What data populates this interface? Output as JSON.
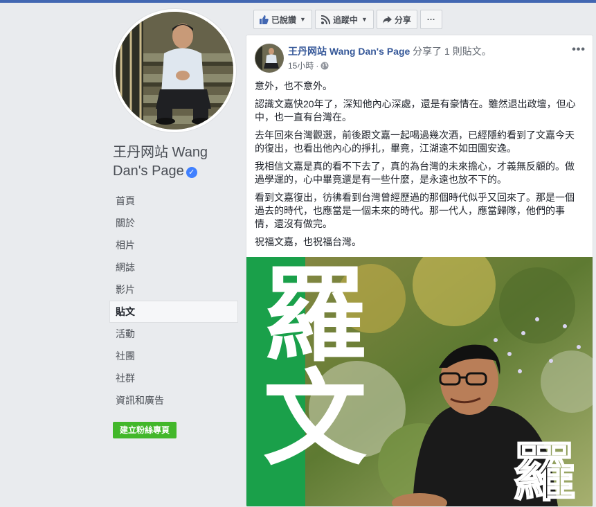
{
  "page": {
    "name": "王丹网站 Wang Dan's Page",
    "verified_mark": "✓"
  },
  "nav": {
    "items": [
      {
        "label": "首頁"
      },
      {
        "label": "關於"
      },
      {
        "label": "相片"
      },
      {
        "label": "網誌"
      },
      {
        "label": "影片"
      },
      {
        "label": "貼文",
        "active": true
      },
      {
        "label": "活動"
      },
      {
        "label": "社團"
      },
      {
        "label": "社群"
      },
      {
        "label": "資訊和廣告"
      }
    ],
    "create_page_label": "建立粉絲專頁"
  },
  "actions": {
    "liked_label": "已說讚",
    "following_label": "追蹤中",
    "share_label": "分享",
    "more_label": "···"
  },
  "post": {
    "author": "王丹网站 Wang Dan's Page",
    "action_text": "分享了 1 則貼文。",
    "time": "15小時",
    "menu": "•••",
    "paragraphs": [
      "意外，也不意外。",
      "認識文嘉快20年了，深知他內心深處，還是有豪情在。雖然退出政壇，但心中，也一直有台灣在。",
      "去年回來台灣觀選，前後跟文嘉一起喝過幾次酒，已經隱約看到了文嘉今天的復出，也看出他內心的掙扎，畢竟，江湖遠不如田園安逸。",
      "我相信文嘉是真的看不下去了，真的為台灣的未來擔心，才義無反顧的。做過學運的，心中畢竟還是有一些什麼，是永遠也放不下的。",
      "看到文嘉復出，彷彿看到台灣曾經歷過的那個時代似乎又回來了。那是一個過去的時代，也應當是一個未來的時代。那一代人，應當歸隊，他們的事情，還沒有做完。",
      "祝福文嘉，也祝福台灣。"
    ],
    "image": {
      "big_text": [
        "羅",
        "文"
      ],
      "corner_text": "羅"
    }
  },
  "colors": {
    "brand_blue": "#4267b2",
    "link": "#365899",
    "green_button": "#42b72a",
    "poster_green": "#1aa04a"
  }
}
